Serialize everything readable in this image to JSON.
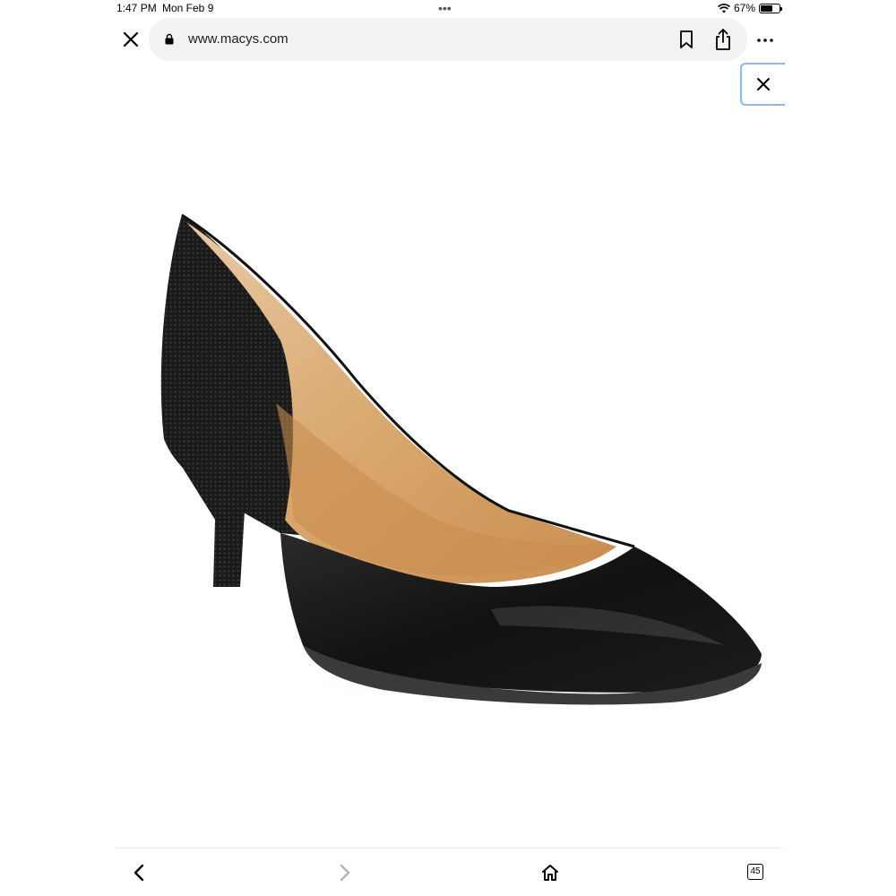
{
  "status_bar": {
    "time": "1:47 PM",
    "date": "Mon Feb 9",
    "dots": "•••",
    "battery_percent": "67%",
    "battery_level": 0.67,
    "wifi_icon": "wifi-icon",
    "battery_icon": "battery-icon"
  },
  "browser": {
    "url": "www.macys.com",
    "close_icon": "close-icon",
    "lock_icon": "lock-icon",
    "bookmark_icon": "bookmark-icon",
    "share_icon": "share-icon",
    "more_icon": "more-icon"
  },
  "overlay": {
    "close_icon": "close-icon",
    "border_color": "#8fb7e8"
  },
  "product": {
    "image_subject": "black pointed-toe kitten heel pump"
  },
  "toolbar": {
    "back_icon": "chevron-left-icon",
    "forward_icon": "chevron-right-icon",
    "home_icon": "home-icon",
    "tabs_icon": "tabs-icon",
    "tabs_count": "45"
  }
}
